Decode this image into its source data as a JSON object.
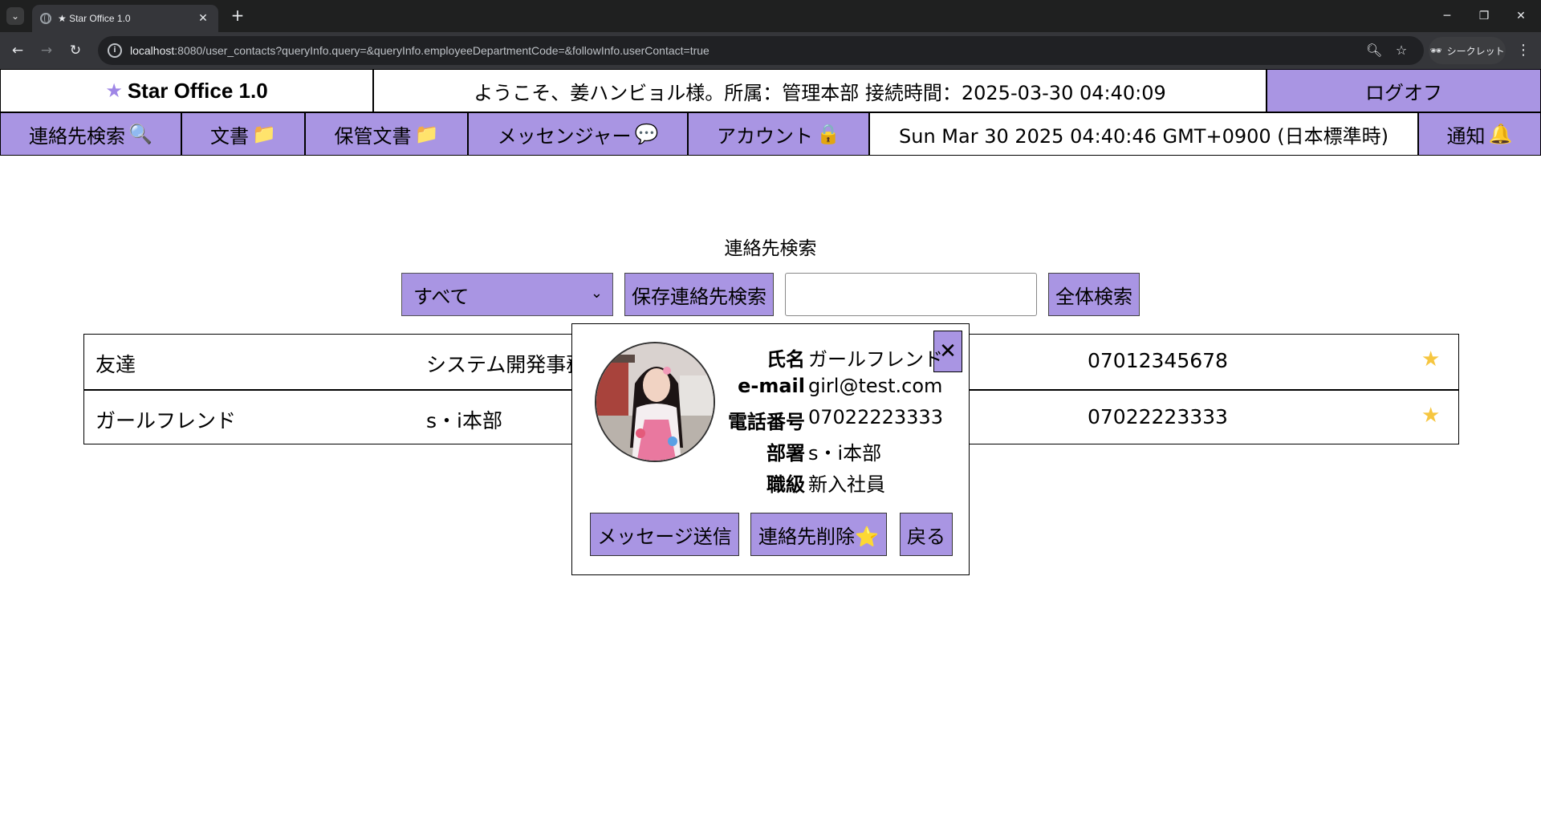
{
  "browser": {
    "tab_title": "★ Star Office 1.0",
    "url_host": "localhost",
    "url_rest": ":8080/user_contacts?queryInfo.query=&queryInfo.employeeDepartmentCode=&followInfo.userContact=true",
    "incognito_label": "シークレット"
  },
  "header": {
    "brand": "Star Office 1.0",
    "welcome": "ようこそ、姜ハンビョル様。所属：管理本部 接続時間：2025-03-30 04:40:09",
    "logoff": "ログオフ"
  },
  "menu": {
    "items": [
      {
        "label": "連絡先検索",
        "icon": "🔍"
      },
      {
        "label": "文書",
        "icon": "📁"
      },
      {
        "label": "保管文書",
        "icon": "📁"
      },
      {
        "label": "メッセンジャー",
        "icon": "💬"
      },
      {
        "label": "アカウント",
        "icon": "🔒"
      }
    ],
    "datetime": "Sun Mar 30 2025 04:40:46 GMT+0900 (日本標準時)",
    "notify": {
      "label": "通知",
      "icon": "🔔"
    }
  },
  "search": {
    "title": "連絡先検索",
    "select_value": "すべて",
    "saved_search_button": "保存連絡先検索",
    "query_value": "",
    "all_search_button": "全体検索"
  },
  "contacts": [
    {
      "name": "友達",
      "department": "システム開発事務",
      "phone": "07012345678"
    },
    {
      "name": "ガールフレンド",
      "department": "s・i本部",
      "phone": "07022223333"
    }
  ],
  "modal": {
    "close_label": "✕",
    "fields": [
      {
        "label": "氏名",
        "value": "ガールフレンド"
      },
      {
        "label": "e-mail",
        "value": "girl@test.com"
      },
      {
        "label": "電話番号",
        "value": "07022223333"
      },
      {
        "label": "部署",
        "value": "s・i本部"
      },
      {
        "label": "職級",
        "value": "新入社員"
      }
    ],
    "send_message_button": "メッセージ送信",
    "delete_contact_button": "連絡先削除⭐",
    "back_button": "戻る"
  },
  "colors": {
    "accent": "#a995e3",
    "favorite_star": "#f6c640"
  }
}
